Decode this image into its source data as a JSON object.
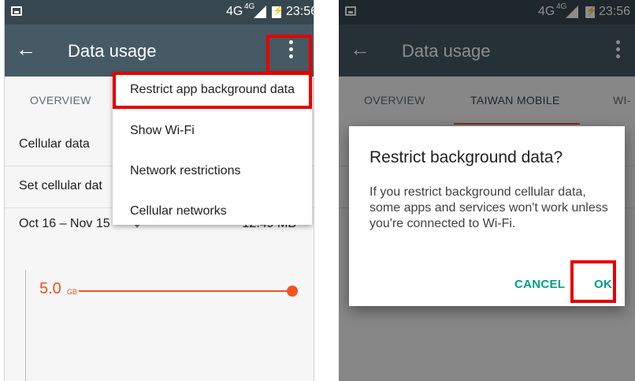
{
  "colors": {
    "status_bar": "#37474f",
    "toolbar": "#455a64",
    "accent": "#f4511e",
    "dialog_button": "#00a08a",
    "highlight": "#e60000"
  },
  "status_bar": {
    "network": "4G",
    "network_sup": "4G",
    "time": "23:56"
  },
  "left_screen": {
    "toolbar": {
      "back_icon": "arrow-left-icon",
      "title": "Data usage",
      "overflow_icon": "more-vert-icon"
    },
    "tabs": [
      {
        "label": "OVERVIEW"
      }
    ],
    "rows": [
      {
        "label": "Cellular data"
      },
      {
        "label": "Set cellular dat"
      }
    ],
    "cycle": {
      "range": "Oct 16 – Nov 15",
      "amount": "12.49 MB"
    },
    "chart": {
      "limit_value": "5.0",
      "limit_unit": "GB"
    },
    "menu": [
      {
        "label": "Restrict app background data"
      },
      {
        "label": "Show Wi-Fi"
      },
      {
        "label": "Network restrictions"
      },
      {
        "label": "Cellular networks"
      }
    ]
  },
  "right_screen": {
    "toolbar": {
      "back_icon": "arrow-left-icon",
      "title": "Data usage",
      "overflow_icon": "more-vert-icon"
    },
    "tabs": [
      {
        "label": "OVERVIEW"
      },
      {
        "label": "TAIWAN MOBILE"
      },
      {
        "label": "WI-"
      }
    ],
    "dialog": {
      "title": "Restrict background data?",
      "message": "If you restrict background cellular data, some apps and services won't work unless you're connected to Wi-Fi.",
      "cancel_label": "CANCEL",
      "ok_label": "OK"
    }
  }
}
